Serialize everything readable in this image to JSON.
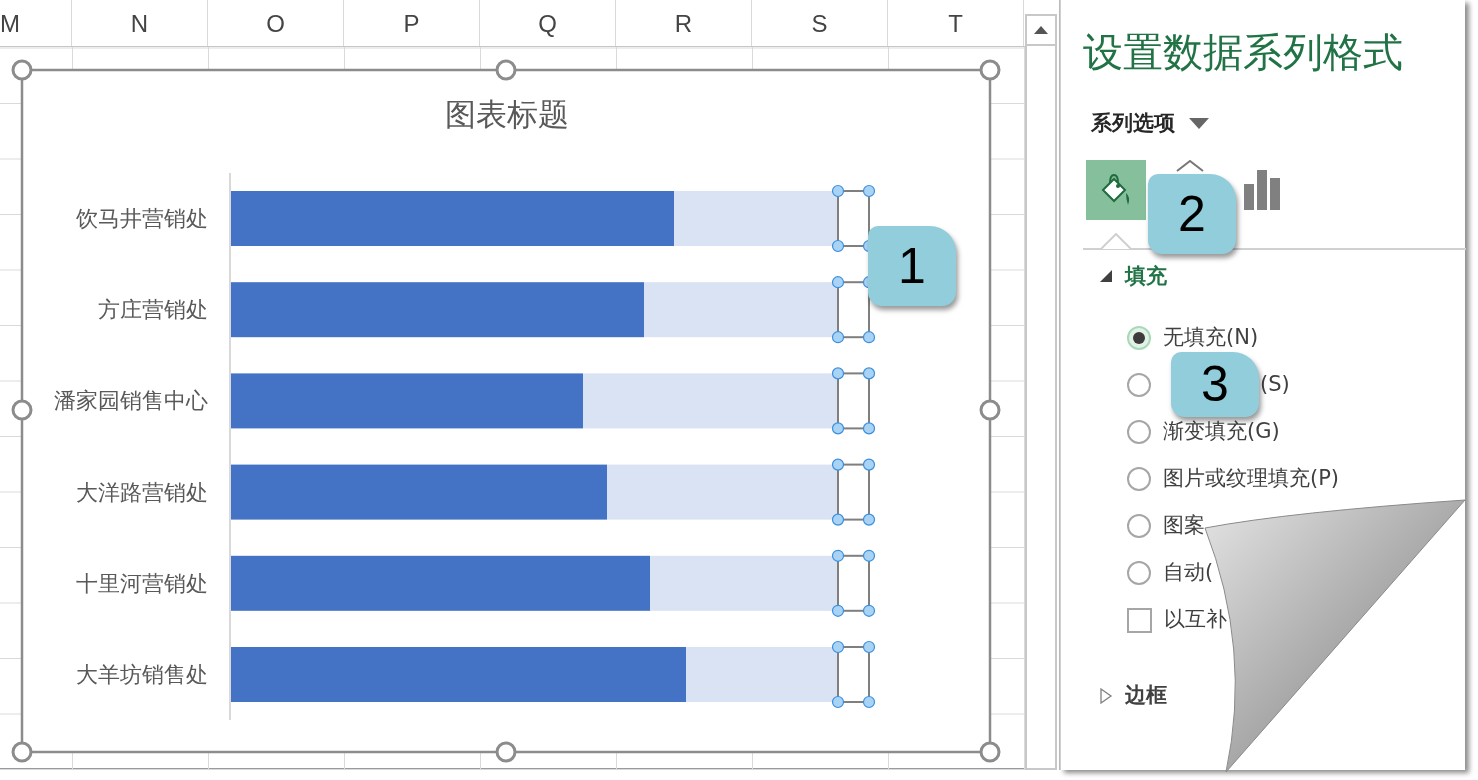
{
  "sheet": {
    "columns": [
      {
        "label": "M"
      },
      {
        "label": "N"
      },
      {
        "label": "O"
      },
      {
        "label": "P"
      },
      {
        "label": "Q"
      },
      {
        "label": "R"
      },
      {
        "label": "S"
      },
      {
        "label": "T"
      }
    ]
  },
  "chart": {
    "title": "图表标题",
    "categories": [
      {
        "label": "饮马井营销处"
      },
      {
        "label": "方庄营销处"
      },
      {
        "label": "潘家园销售中心"
      },
      {
        "label": "大洋路营销处"
      },
      {
        "label": "十里河营销处"
      },
      {
        "label": "大羊坊销售处"
      }
    ]
  },
  "panel": {
    "title": "设置数据系列格式",
    "options_menu": "系列选项",
    "tabs": [
      {
        "kind": "fill",
        "selected": true
      },
      {
        "kind": "effects",
        "selected": false
      },
      {
        "kind": "series",
        "selected": false
      }
    ],
    "sections": [
      {
        "title": "填充",
        "expanded": true,
        "options": [
          {
            "kind": "radio",
            "label": "无填充(N)",
            "selected": true
          },
          {
            "kind": "radio",
            "label": "(S)",
            "selected": false
          },
          {
            "kind": "radio",
            "label": "渐变填充(G)",
            "selected": false
          },
          {
            "kind": "radio",
            "label": "图片或纹理填充(P)",
            "selected": false
          },
          {
            "kind": "radio",
            "label": "图案",
            "selected": false
          },
          {
            "kind": "radio",
            "label": "自动(",
            "selected": false
          },
          {
            "kind": "checkbox",
            "label": "以互补",
            "checked": false
          }
        ]
      },
      {
        "title": "边框",
        "expanded": false
      }
    ]
  },
  "callouts": [
    {
      "label": "1"
    },
    {
      "label": "2"
    },
    {
      "label": "3"
    }
  ]
}
